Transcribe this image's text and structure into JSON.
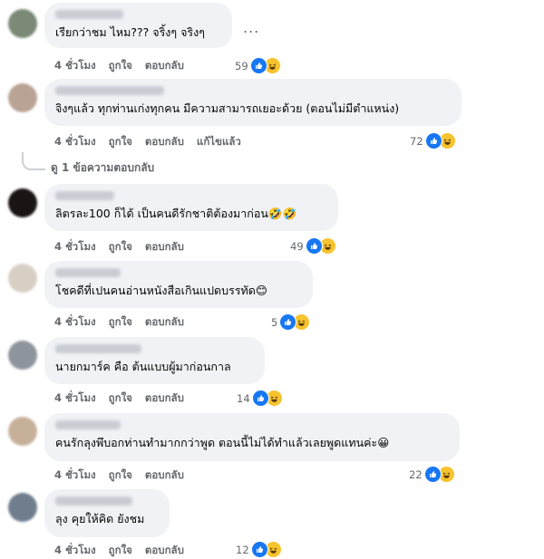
{
  "more_label": "...",
  "view_replies": "ดู 1 ข้อความตอบกลับ",
  "comments": [
    {
      "text": "เรียกว่าชม ไหม??? จริ้งๆ จริงๆ",
      "time": "4 ชั่วโมง",
      "like": "ถูกใจ",
      "reply": "ตอบกลับ",
      "edited": "",
      "count": "59"
    },
    {
      "text": "จิงๆแล้ว ทุกท่านเก่งทุกคน มีความสามารถเยอะด้วย (ตอนไม่มีตำแหน่ง)",
      "time": "4 ชั่วโมง",
      "like": "ถูกใจ",
      "reply": "ตอบกลับ",
      "edited": "แก้ไขแล้ว",
      "count": "72"
    },
    {
      "text": "ลิตรละ100 ก็ได้ เป็นคนดีรักชาติต้องมาก่อน🤣🤣",
      "time": "4 ชั่วโมง",
      "like": "ถูกใจ",
      "reply": "ตอบกลับ",
      "edited": "",
      "count": "49"
    },
    {
      "text": "โชคดีที่เปนคนอ่านหนังสือเกินแปดบรรทัด😊",
      "time": "4 ชั่วโมง",
      "like": "ถูกใจ",
      "reply": "ตอบกลับ",
      "edited": "",
      "count": "5"
    },
    {
      "text": "นายกมาร์ค คือ ต้นแบบผู้มาก่อนกาล",
      "time": "4 ชั่วโมง",
      "like": "ถูกใจ",
      "reply": "ตอบกลับ",
      "edited": "",
      "count": "14"
    },
    {
      "text": "คนรักลุงพึบอกท่านทำมากกว่าพูด ตอนนี้ไม่ได้ทำแล้วเลยพูดแทนค่ะ😀",
      "time": "4 ชั่วโมง",
      "like": "ถูกใจ",
      "reply": "ตอบกลับ",
      "edited": "",
      "count": "22"
    },
    {
      "text": "ลุง คุยให้คิด ยังชม",
      "time": "4 ชั่วโมง",
      "like": "ถูกใจ",
      "reply": "ตอบกลับ",
      "edited": "",
      "count": "12"
    }
  ],
  "icons": {
    "like": "thumbs-up-icon",
    "haha": "laughing-face-icon",
    "more": "more-options-icon"
  },
  "colors": {
    "bubble": "#f0f2f5",
    "like_blue": "#1877f2",
    "haha_yellow": "#f7c32e",
    "meta_gray": "#65676b"
  }
}
